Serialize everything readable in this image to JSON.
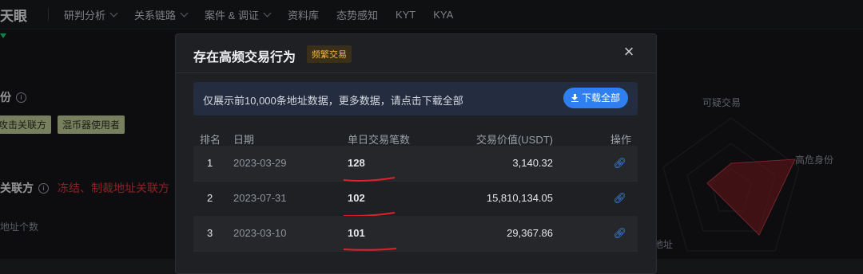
{
  "brand": "天眼",
  "nav": [
    {
      "label": "研判分析",
      "dropdown": true
    },
    {
      "label": "关系链路",
      "dropdown": true
    },
    {
      "label": "案件 & 调证",
      "dropdown": true
    },
    {
      "label": "资料库",
      "dropdown": false
    },
    {
      "label": "态势感知",
      "dropdown": false
    },
    {
      "label": "KYT",
      "dropdown": false
    },
    {
      "label": "KYA",
      "dropdown": false
    }
  ],
  "background": {
    "section1_title": "份",
    "tags": [
      "攻击关联方",
      "混币器使用者"
    ],
    "section2_title": "关联方",
    "section2_red": "冻结、制裁地址关联方",
    "sub_label": "地址个数",
    "radar_labels": {
      "top": "可疑交易",
      "right": "高危身份",
      "bottom": "地址"
    }
  },
  "modal": {
    "title": "存在高频交易行为",
    "badge": "频繁交易",
    "notice": "仅展示前10,000条地址数据，更多数据，请点击下载全部",
    "download_label": "下载全部",
    "columns": [
      "排名",
      "日期",
      "单日交易笔数",
      "交易价值(USDT)",
      "操作"
    ],
    "rows": [
      {
        "rank": "1",
        "date": "2023-03-29",
        "count": "128",
        "value": "3,140.32"
      },
      {
        "rank": "2",
        "date": "2023-07-31",
        "count": "102",
        "value": "15,810,134.05"
      },
      {
        "rank": "3",
        "date": "2023-03-10",
        "count": "101",
        "value": "29,367.86"
      }
    ]
  },
  "colors": {
    "accent": "#2f7ff0",
    "badge": "#f5b43a",
    "danger": "#d4373d",
    "annotation": "#e0202a"
  }
}
